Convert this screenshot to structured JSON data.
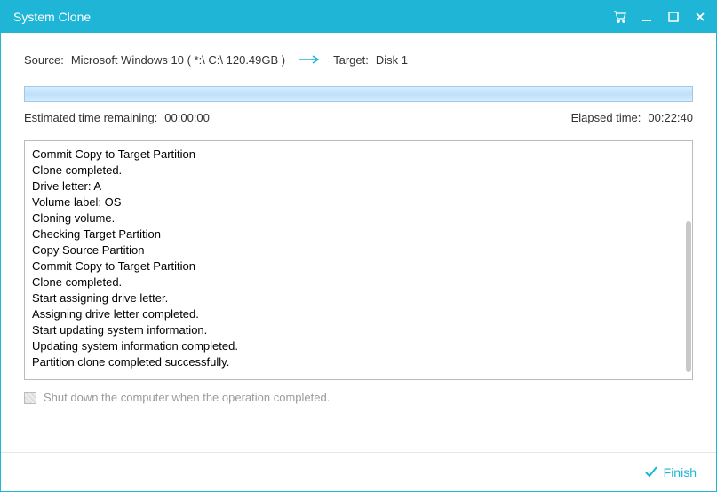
{
  "window": {
    "title": "System Clone"
  },
  "header": {
    "source_label": "Source:",
    "source_value": "Microsoft Windows 10 ( *:\\ C:\\  120.49GB )",
    "target_label": "Target:",
    "target_value": "Disk 1"
  },
  "progress": {
    "est_label": "Estimated time remaining:",
    "est_value": "00:00:00",
    "elapsed_label": "Elapsed time:",
    "elapsed_value": "00:22:40"
  },
  "log": {
    "lines": [
      "Commit Copy to Target Partition",
      "Clone completed.",
      "Drive letter: A",
      "Volume label: OS",
      "Cloning volume.",
      "Checking Target Partition",
      "Copy Source Partition",
      "Commit Copy to Target Partition",
      "Clone completed.",
      "Start assigning drive letter.",
      "Assigning drive letter completed.",
      "Start updating system information.",
      "Updating system information completed.",
      "Partition clone completed successfully."
    ]
  },
  "shutdown_label": "Shut down the computer when the operation completed.",
  "footer": {
    "finish_label": "Finish"
  }
}
